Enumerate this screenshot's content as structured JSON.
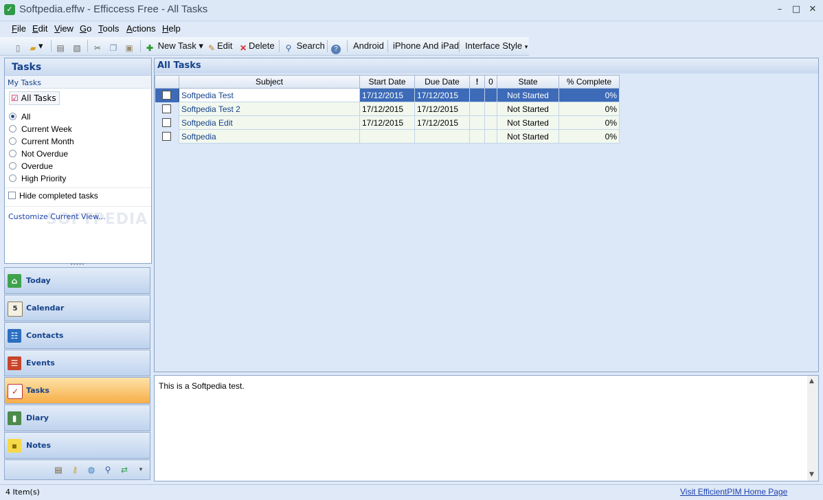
{
  "window": {
    "title": "Softpedia.effw - Efficcess Free - All Tasks"
  },
  "menu": [
    "File",
    "Edit",
    "View",
    "Go",
    "Tools",
    "Actions",
    "Help"
  ],
  "toolbar": {
    "new_task": "New Task",
    "edit": "Edit",
    "delete": "Delete",
    "search": "Search",
    "android": "Android",
    "iphone": "iPhone And iPad",
    "interface_style": "Interface Style"
  },
  "left": {
    "header": "Tasks",
    "section": "My Tasks",
    "all_tasks_button": "All Tasks",
    "filters": [
      {
        "label": "All",
        "selected": true
      },
      {
        "label": "Current Week",
        "selected": false
      },
      {
        "label": "Current Month",
        "selected": false
      },
      {
        "label": "Not Overdue",
        "selected": false
      },
      {
        "label": "Overdue",
        "selected": false
      },
      {
        "label": "High Priority",
        "selected": false
      }
    ],
    "hide_completed": "Hide completed tasks",
    "customize": "Customize Current View...",
    "watermark": "SOFTPEDIA"
  },
  "nav": [
    {
      "label": "Today",
      "icon": "home-icon"
    },
    {
      "label": "Calendar",
      "icon": "calendar-icon"
    },
    {
      "label": "Contacts",
      "icon": "contacts-icon"
    },
    {
      "label": "Events",
      "icon": "events-icon"
    },
    {
      "label": "Tasks",
      "icon": "tasks-icon",
      "active": true
    },
    {
      "label": "Diary",
      "icon": "diary-icon"
    },
    {
      "label": "Notes",
      "icon": "notes-icon"
    }
  ],
  "main": {
    "header": "All Tasks",
    "columns": {
      "subject": "Subject",
      "start": "Start Date",
      "due": "Due Date",
      "priority": "!",
      "attach": "0",
      "state": "State",
      "complete": "% Complete"
    },
    "rows": [
      {
        "subject": "Softpedia Test",
        "start": "17/12/2015",
        "due": "17/12/2015",
        "state": "Not Started",
        "complete": "0%",
        "selected": true
      },
      {
        "subject": "Softpedia Test 2",
        "start": "17/12/2015",
        "due": "17/12/2015",
        "state": "Not Started",
        "complete": "0%"
      },
      {
        "subject": "Softpedia Edit",
        "start": "17/12/2015",
        "due": "17/12/2015",
        "state": "Not Started",
        "complete": "0%"
      },
      {
        "subject": "Softpedia",
        "start": "",
        "due": "",
        "state": "Not Started",
        "complete": "0%"
      }
    ]
  },
  "notes": {
    "text": "This is a Softpedia test."
  },
  "status": {
    "count": "4 Item(s)",
    "link": "Visit EfficientPIM Home Page"
  },
  "colors": {
    "accent": "#15428b",
    "selection": "#3d6bb8",
    "active_nav": "#f7ae47"
  }
}
